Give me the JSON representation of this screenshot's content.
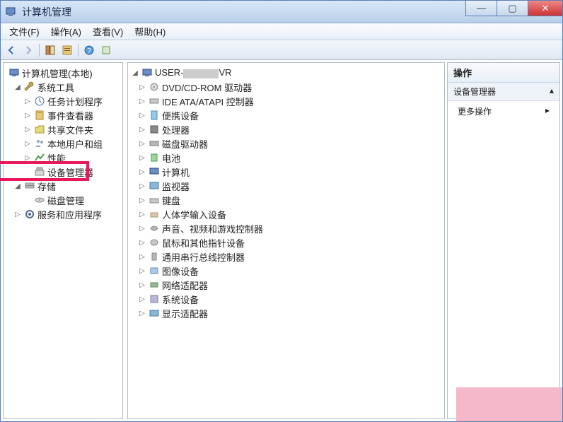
{
  "window": {
    "title": "计算机管理"
  },
  "menu": {
    "file": "文件(F)",
    "action": "操作(A)",
    "view": "查看(V)",
    "help": "帮助(H)"
  },
  "left": {
    "root": "计算机管理(本地)",
    "sys_tools": "系统工具",
    "task_sched": "任务计划程序",
    "event_viewer": "事件查看器",
    "shared_folders": "共享文件夹",
    "local_users": "本地用户和组",
    "perf": "性能",
    "device_mgr": "设备管理器",
    "storage": "存储",
    "disk_mgmt": "磁盘管理",
    "services_apps": "服务和应用程序"
  },
  "mid": {
    "root_prefix": "USER-",
    "root_suffix": "VR",
    "items": [
      "DVD/CD-ROM 驱动器",
      "IDE ATA/ATAPI 控制器",
      "便携设备",
      "处理器",
      "磁盘驱动器",
      "电池",
      "计算机",
      "监视器",
      "键盘",
      "人体学输入设备",
      "声音、视频和游戏控制器",
      "鼠标和其他指针设备",
      "通用串行总线控制器",
      "图像设备",
      "网络适配器",
      "系统设备",
      "显示适配器"
    ]
  },
  "right": {
    "header": "操作",
    "section": "设备管理器",
    "more": "更多操作"
  }
}
